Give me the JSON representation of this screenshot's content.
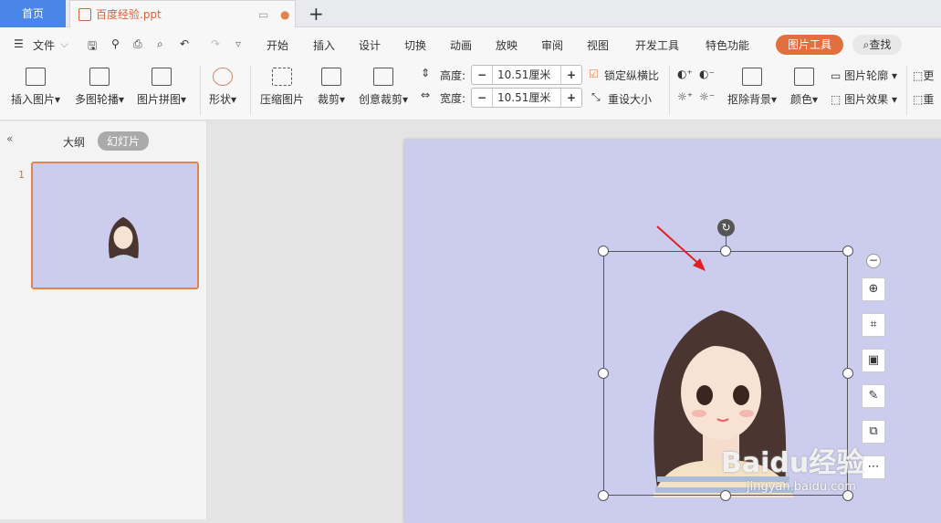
{
  "tabs": {
    "home": "首页",
    "doc": "百度经验.ppt",
    "new": "+"
  },
  "menu": {
    "file": "文件",
    "items": [
      "开始",
      "插入",
      "设计",
      "切换",
      "动画",
      "放映",
      "审阅",
      "视图",
      "开发工具",
      "特色功能"
    ],
    "picture_tools": "图片工具",
    "search": "查找"
  },
  "ribbon": {
    "insert_picture": "插入图片",
    "multi_carousel": "多图轮播",
    "picture_collage": "图片拼图",
    "shape": "形状",
    "compress": "压缩图片",
    "crop": "裁剪",
    "creative_crop": "创意裁剪",
    "height_label": "高度:",
    "width_label": "宽度:",
    "height_value": "10.51厘米",
    "width_value": "10.51厘米",
    "lock_ratio": "锁定纵横比",
    "reset_size": "重设大小",
    "remove_bg": "抠除背景",
    "color": "颜色",
    "outline": "图片轮廓",
    "effects": "图片效果",
    "more1": "更",
    "more2": "重"
  },
  "left": {
    "outline_tab": "大纲",
    "slides_tab": "幻灯片",
    "slide_number": "1"
  },
  "watermark": {
    "brand": "Baidu经验",
    "url": "jingyan.baidu.com"
  }
}
